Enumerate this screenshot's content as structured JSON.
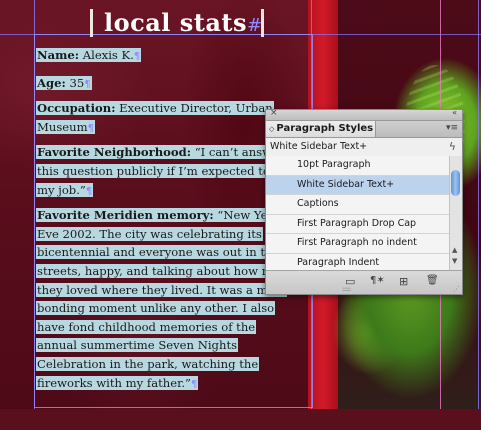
{
  "document": {
    "heading": "local stats",
    "heading_marker": "#",
    "paragraph_marker": "¶",
    "paragraphs": [
      {
        "label": "Name:",
        "text": " Alexis K."
      },
      {
        "label": "Age:",
        "text": " 35"
      },
      {
        "label": "Occupation:",
        "text": " Executive Director, Urban Museum"
      },
      {
        "label": "Favorite Neighborhood:",
        "text": " “I can’t answer this question publicly if I’m expected to do my job.”"
      },
      {
        "label": "Favorite Meridien memory:",
        "text": " “New Years Eve 2002. The city was celebrating its bicentennial and everyone was out in the streets, happy, and talking about how much they loved where they lived. It was a mass bonding moment unlike any other. I also have fond childhood memories of the annual summertime Seven Nights Celebration in the park, watching the fireworks with my father.”"
      }
    ]
  },
  "panel": {
    "close_glyph": "×",
    "collapse_glyph": "«",
    "tab_arrow": "◇",
    "tab_label": "Paragraph Styles",
    "menu_glyph": "▾≡",
    "current_style": "White Sidebar Text+",
    "new_from_selection_glyph": "ϟ",
    "styles": [
      {
        "label": "10pt Paragraph"
      },
      {
        "label": "White Sidebar Text+"
      },
      {
        "label": "Captions"
      },
      {
        "label": "First Paragraph Drop Cap"
      },
      {
        "label": "First Paragraph no indent"
      },
      {
        "label": "Paragraph Indent"
      }
    ],
    "selected_index": 1,
    "scroll_up_glyph": "▲",
    "scroll_down_glyph": "▼",
    "footer": {
      "folder_glyph": "▭",
      "clear_overrides_glyph": "¶✶",
      "new_style_glyph": "⊞",
      "delete_glyph": "🗑",
      "grip_glyph": "::::::::",
      "resize_glyph": "⋰"
    }
  },
  "colors": {
    "text_highlight": "#b7d8e0",
    "selected_style": "#bcd3ee",
    "guide": "#8c78ff"
  }
}
